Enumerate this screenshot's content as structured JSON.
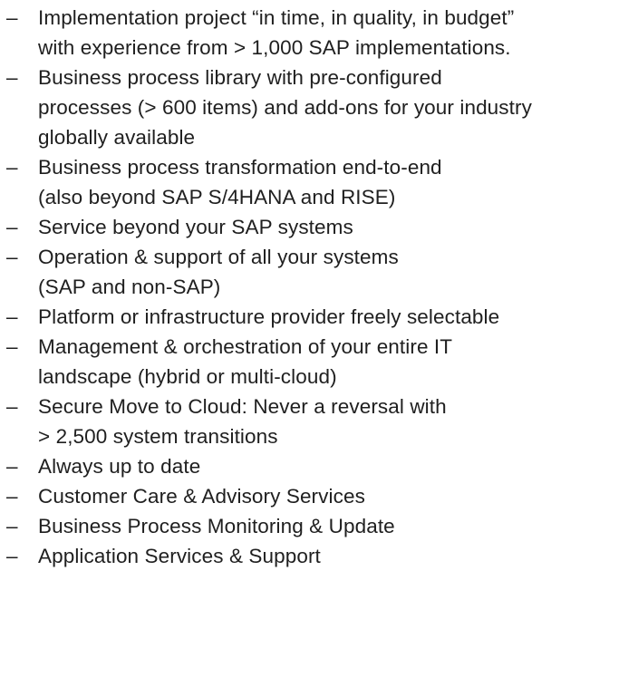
{
  "list": {
    "marker": "–",
    "items": [
      {
        "lines": [
          "Implementation project “in time, in quality, in budget”",
          "with experience from > 1,000 SAP implementations."
        ]
      },
      {
        "lines": [
          "Business process library with pre-configured",
          "processes (> 600 items) and add-ons for your industry",
          "globally available"
        ]
      },
      {
        "lines": [
          "Business process transformation end-to-end",
          "(also beyond SAP S/4HANA and RISE)"
        ]
      },
      {
        "lines": [
          "Service beyond your SAP systems"
        ]
      },
      {
        "lines": [
          "Operation & support of all your systems",
          "(SAP and non-SAP)"
        ]
      },
      {
        "lines": [
          "Platform or infrastructure provider freely selectable"
        ]
      },
      {
        "lines": [
          "Management & orchestration of your entire IT",
          "landscape (hybrid or multi-cloud)"
        ]
      },
      {
        "lines": [
          "Secure Move to Cloud: Never a reversal with",
          "> 2,500 system transitions"
        ]
      },
      {
        "lines": [
          "Always up to date"
        ]
      },
      {
        "lines": [
          "Customer Care & Advisory Services"
        ]
      },
      {
        "lines": [
          "Business Process Monitoring & Update"
        ]
      },
      {
        "lines": [
          "Application Services & Support"
        ]
      }
    ]
  }
}
